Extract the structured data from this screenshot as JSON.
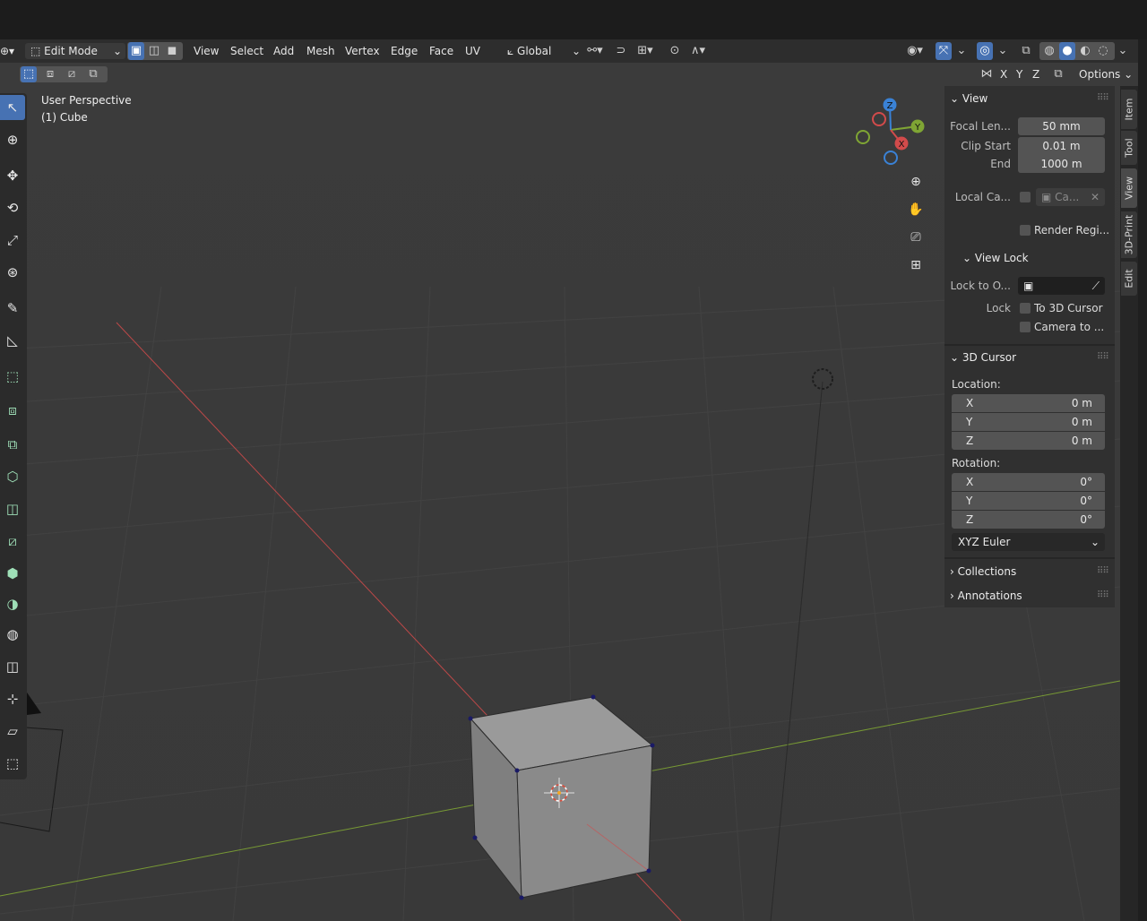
{
  "header": {
    "mode": "Edit Mode",
    "menu": [
      "View",
      "Select",
      "Add",
      "Mesh",
      "Vertex",
      "Edge",
      "Face",
      "UV"
    ],
    "orientation": "Global",
    "icons": [
      "mode-icon",
      "vertex-select-icon",
      "edge-select-icon",
      "face-select-icon",
      "orientation-icon",
      "pivot-icon",
      "snap-icon",
      "snap-increment-icon",
      "proportional-edit-icon",
      "falloff-icon",
      "visibility-icon",
      "gizmo-icon",
      "overlay-icon",
      "xray-icon",
      "wireframe-icon",
      "solid-icon",
      "material-icon",
      "rendered-icon"
    ]
  },
  "row2": {
    "mirror_axes": [
      "X",
      "Y",
      "Z"
    ],
    "options_label": "Options"
  },
  "viewport": {
    "perspective_label": "User Perspective",
    "object_label": "(1) Cube",
    "gizmo_axes": [
      "X",
      "Y",
      "Z"
    ],
    "colors": {
      "x_axis": "#d24b4b",
      "y_axis": "#7fa534",
      "z_axis": "#3a82d6",
      "mesh": "#8e8e8e",
      "vertex": "#1a1a66"
    }
  },
  "toolbar": {
    "tools": [
      "select-box-icon",
      "cursor-icon",
      "move-icon",
      "rotate-icon",
      "scale-icon",
      "transform-icon",
      "annotate-icon",
      "measure-icon",
      "add-cube-icon",
      "extrude-icon",
      "inset-icon",
      "bevel-icon",
      "loop-cut-icon",
      "knife-icon",
      "poly-build-icon",
      "spin-icon",
      "smooth-icon",
      "edge-slide-icon",
      "shrink-fatten-icon",
      "shear-icon",
      "rip-icon"
    ]
  },
  "npanel": {
    "view": {
      "title": "View",
      "focal_label": "Focal Len...",
      "focal_value": "50 mm",
      "clip_start_label": "Clip Start",
      "clip_start_value": "0.01 m",
      "end_label": "End",
      "end_value": "1000 m",
      "local_camera_label": "Local Ca...",
      "local_camera_value": "Ca...",
      "render_region_label": "Render Regi..."
    },
    "view_lock": {
      "title": "View Lock",
      "lock_to_object_label": "Lock to O...",
      "lock_label": "Lock",
      "to_3d_cursor_label": "To 3D Cursor",
      "camera_to_label": "Camera to ..."
    },
    "cursor": {
      "title": "3D Cursor",
      "location_label": "Location:",
      "loc_x_label": "X",
      "loc_x": "0 m",
      "loc_y_label": "Y",
      "loc_y": "0 m",
      "loc_z_label": "Z",
      "loc_z": "0 m",
      "rotation_label": "Rotation:",
      "rot_x_label": "X",
      "rot_x": "0°",
      "rot_y_label": "Y",
      "rot_y": "0°",
      "rot_z_label": "Z",
      "rot_z": "0°",
      "rotation_mode": "XYZ Euler"
    },
    "collections_title": "Collections",
    "annotations_title": "Annotations"
  },
  "sidetabs": [
    "Item",
    "Tool",
    "View",
    "3D-Print",
    "Edit"
  ]
}
